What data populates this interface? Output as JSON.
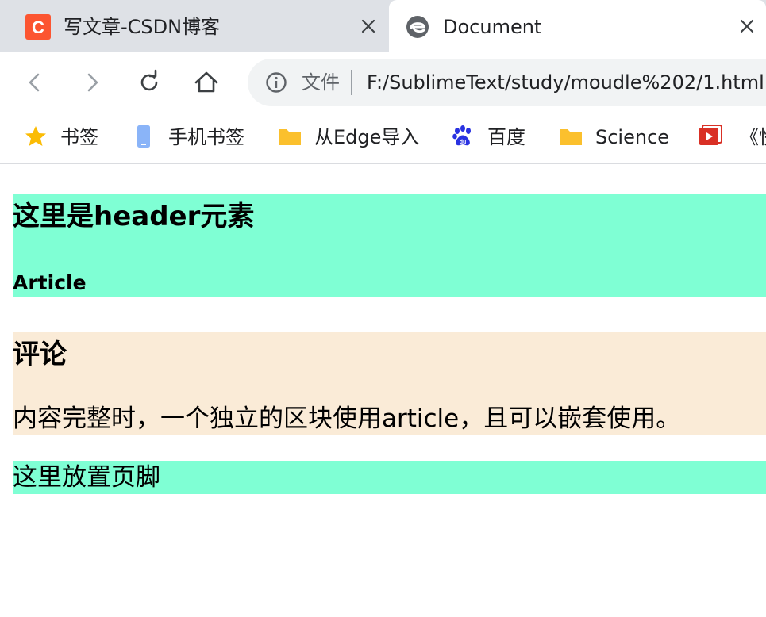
{
  "browser": {
    "tabs": [
      {
        "title": "写文章-CSDN博客",
        "icon": "csdn-logo-icon",
        "active": false
      },
      {
        "title": "Document",
        "icon": "edge-logo-icon",
        "active": true
      }
    ],
    "address_bar": {
      "scheme_label": "文件",
      "url": "F:/SublimeText/study/moudle%202/1.html"
    },
    "bookmarks": [
      {
        "label": "书签",
        "icon": "star-icon"
      },
      {
        "label": "手机书签",
        "icon": "phone-icon"
      },
      {
        "label": "从Edge导入",
        "icon": "folder-icon"
      },
      {
        "label": "百度",
        "icon": "baidu-paw-icon"
      },
      {
        "label": "Science",
        "icon": "folder-icon"
      },
      {
        "label": "《快",
        "icon": "video-icon"
      }
    ]
  },
  "page": {
    "header": {
      "title": "这里是header元素",
      "subtitle": "Article"
    },
    "article": {
      "title": "评论",
      "text": "内容完整时，一个独立的区块使用article，且可以嵌套使用。"
    },
    "footer": {
      "text": "这里放置页脚"
    }
  },
  "colors": {
    "header_bg": "#7fffd4",
    "article_bg": "#faebd7",
    "footer_bg": "#7fffd4",
    "tabstrip_bg": "#dee1e6",
    "csdn_brand": "#fc5531"
  }
}
